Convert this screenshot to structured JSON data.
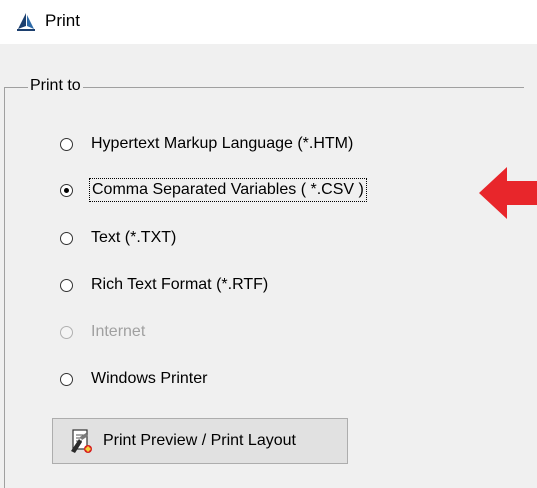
{
  "window": {
    "title": "Print",
    "icon": "sail-icon"
  },
  "group": {
    "legend": "Print to"
  },
  "options": [
    {
      "label": "Hypertext Markup Language (*.HTM)",
      "checked": false,
      "enabled": true
    },
    {
      "label": "Comma Separated Variables ( *.CSV )",
      "checked": true,
      "enabled": true
    },
    {
      "label": "Text (*.TXT)",
      "checked": false,
      "enabled": true
    },
    {
      "label": "Rich Text Format (*.RTF)",
      "checked": false,
      "enabled": true
    },
    {
      "label": "Internet",
      "checked": false,
      "enabled": false
    },
    {
      "label": "Windows Printer",
      "checked": false,
      "enabled": true
    }
  ],
  "preview_button": {
    "label": "Print Preview / Print Layout",
    "icon": "print-preview-icon"
  },
  "colors": {
    "arrow": "#e8262b",
    "background": "#f0f0f0",
    "disabled_text": "#a0a0a0"
  }
}
